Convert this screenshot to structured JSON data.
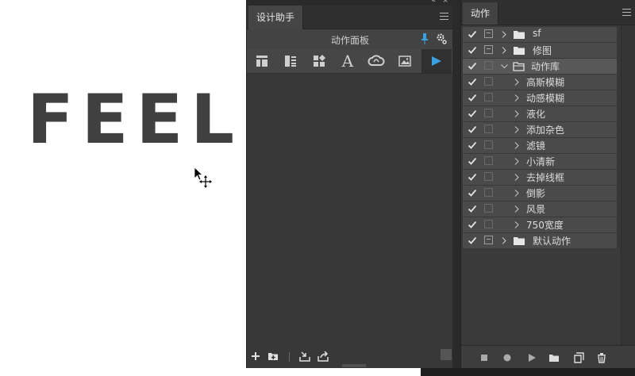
{
  "canvas": {
    "text": "FEEL",
    "text_color": "#404040"
  },
  "helper_panel": {
    "tab_label": "设计助手",
    "subheader_title": "动作面板",
    "accent_color": "#3aa0e0",
    "tools": [
      {
        "icon": "layout-icon"
      },
      {
        "icon": "list-layout-icon"
      },
      {
        "icon": "widgets-icon"
      },
      {
        "icon": "font-icon",
        "glyph": "A"
      },
      {
        "icon": "creative-cloud-icon"
      },
      {
        "icon": "image-icon"
      },
      {
        "icon": "play-icon"
      }
    ]
  },
  "actions_panel": {
    "tab_label": "动作",
    "rows": [
      {
        "label": "sf",
        "type": "set",
        "expanded": false,
        "dialog": true
      },
      {
        "label": "修图",
        "type": "set",
        "expanded": false,
        "dialog": true
      },
      {
        "label": "动作库",
        "type": "set",
        "expanded": true,
        "dialog": false,
        "selected": true
      },
      {
        "label": "高斯模糊",
        "type": "action"
      },
      {
        "label": "动感模糊",
        "type": "action"
      },
      {
        "label": "液化",
        "type": "action"
      },
      {
        "label": "添加杂色",
        "type": "action"
      },
      {
        "label": "滤镜",
        "type": "action"
      },
      {
        "label": "小清新",
        "type": "action"
      },
      {
        "label": "去掉线框",
        "type": "action"
      },
      {
        "label": "倒影",
        "type": "action"
      },
      {
        "label": "风景",
        "type": "action"
      },
      {
        "label": "750宽度",
        "type": "action"
      },
      {
        "label": "默认动作",
        "type": "set",
        "expanded": false,
        "dialog": true
      }
    ]
  }
}
